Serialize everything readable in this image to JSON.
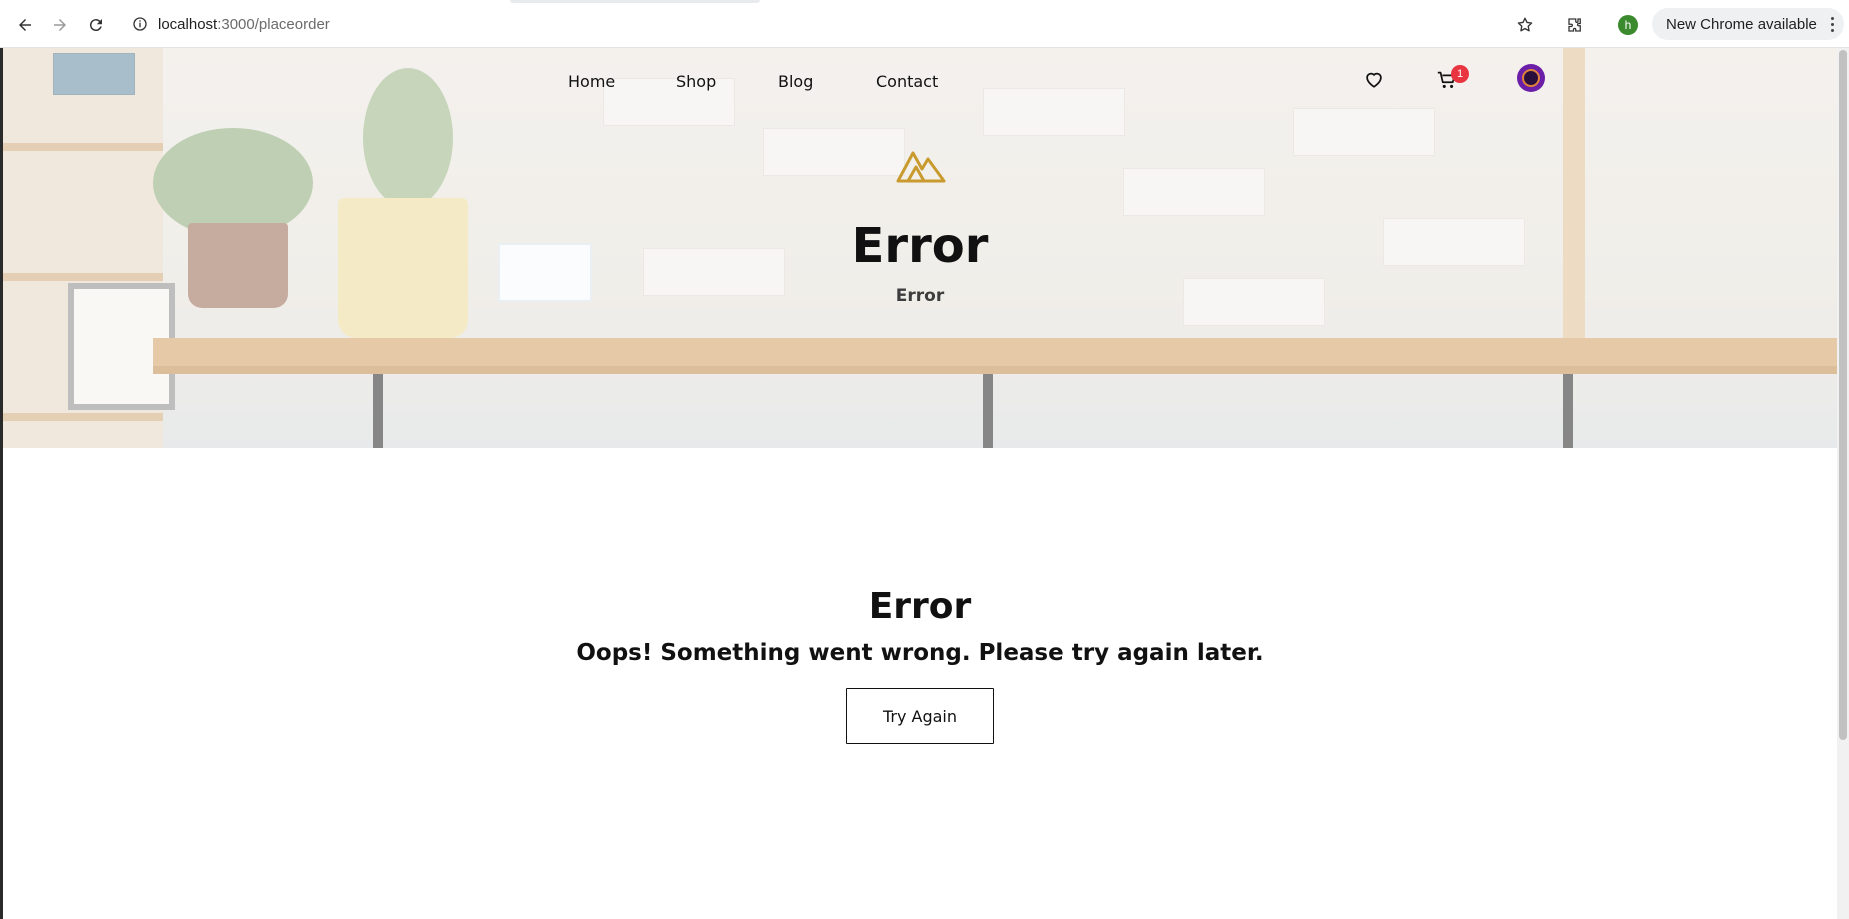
{
  "browser": {
    "url_host": "localhost",
    "url_path": ":3000/placeorder",
    "profile_initial": "h",
    "update_label": "New Chrome available"
  },
  "nav": {
    "links": [
      "Home",
      "Shop",
      "Blog",
      "Contact"
    ],
    "cart_count": "1"
  },
  "hero": {
    "title": "Error",
    "subtitle": "Error"
  },
  "error": {
    "title": "Error",
    "message": "Oops! Something went wrong. Please try again later.",
    "button_label": "Try Again"
  },
  "colors": {
    "logo_gold": "#c99a2e",
    "badge_red": "#e9353f",
    "avatar_purple": "#6b1fa8"
  }
}
